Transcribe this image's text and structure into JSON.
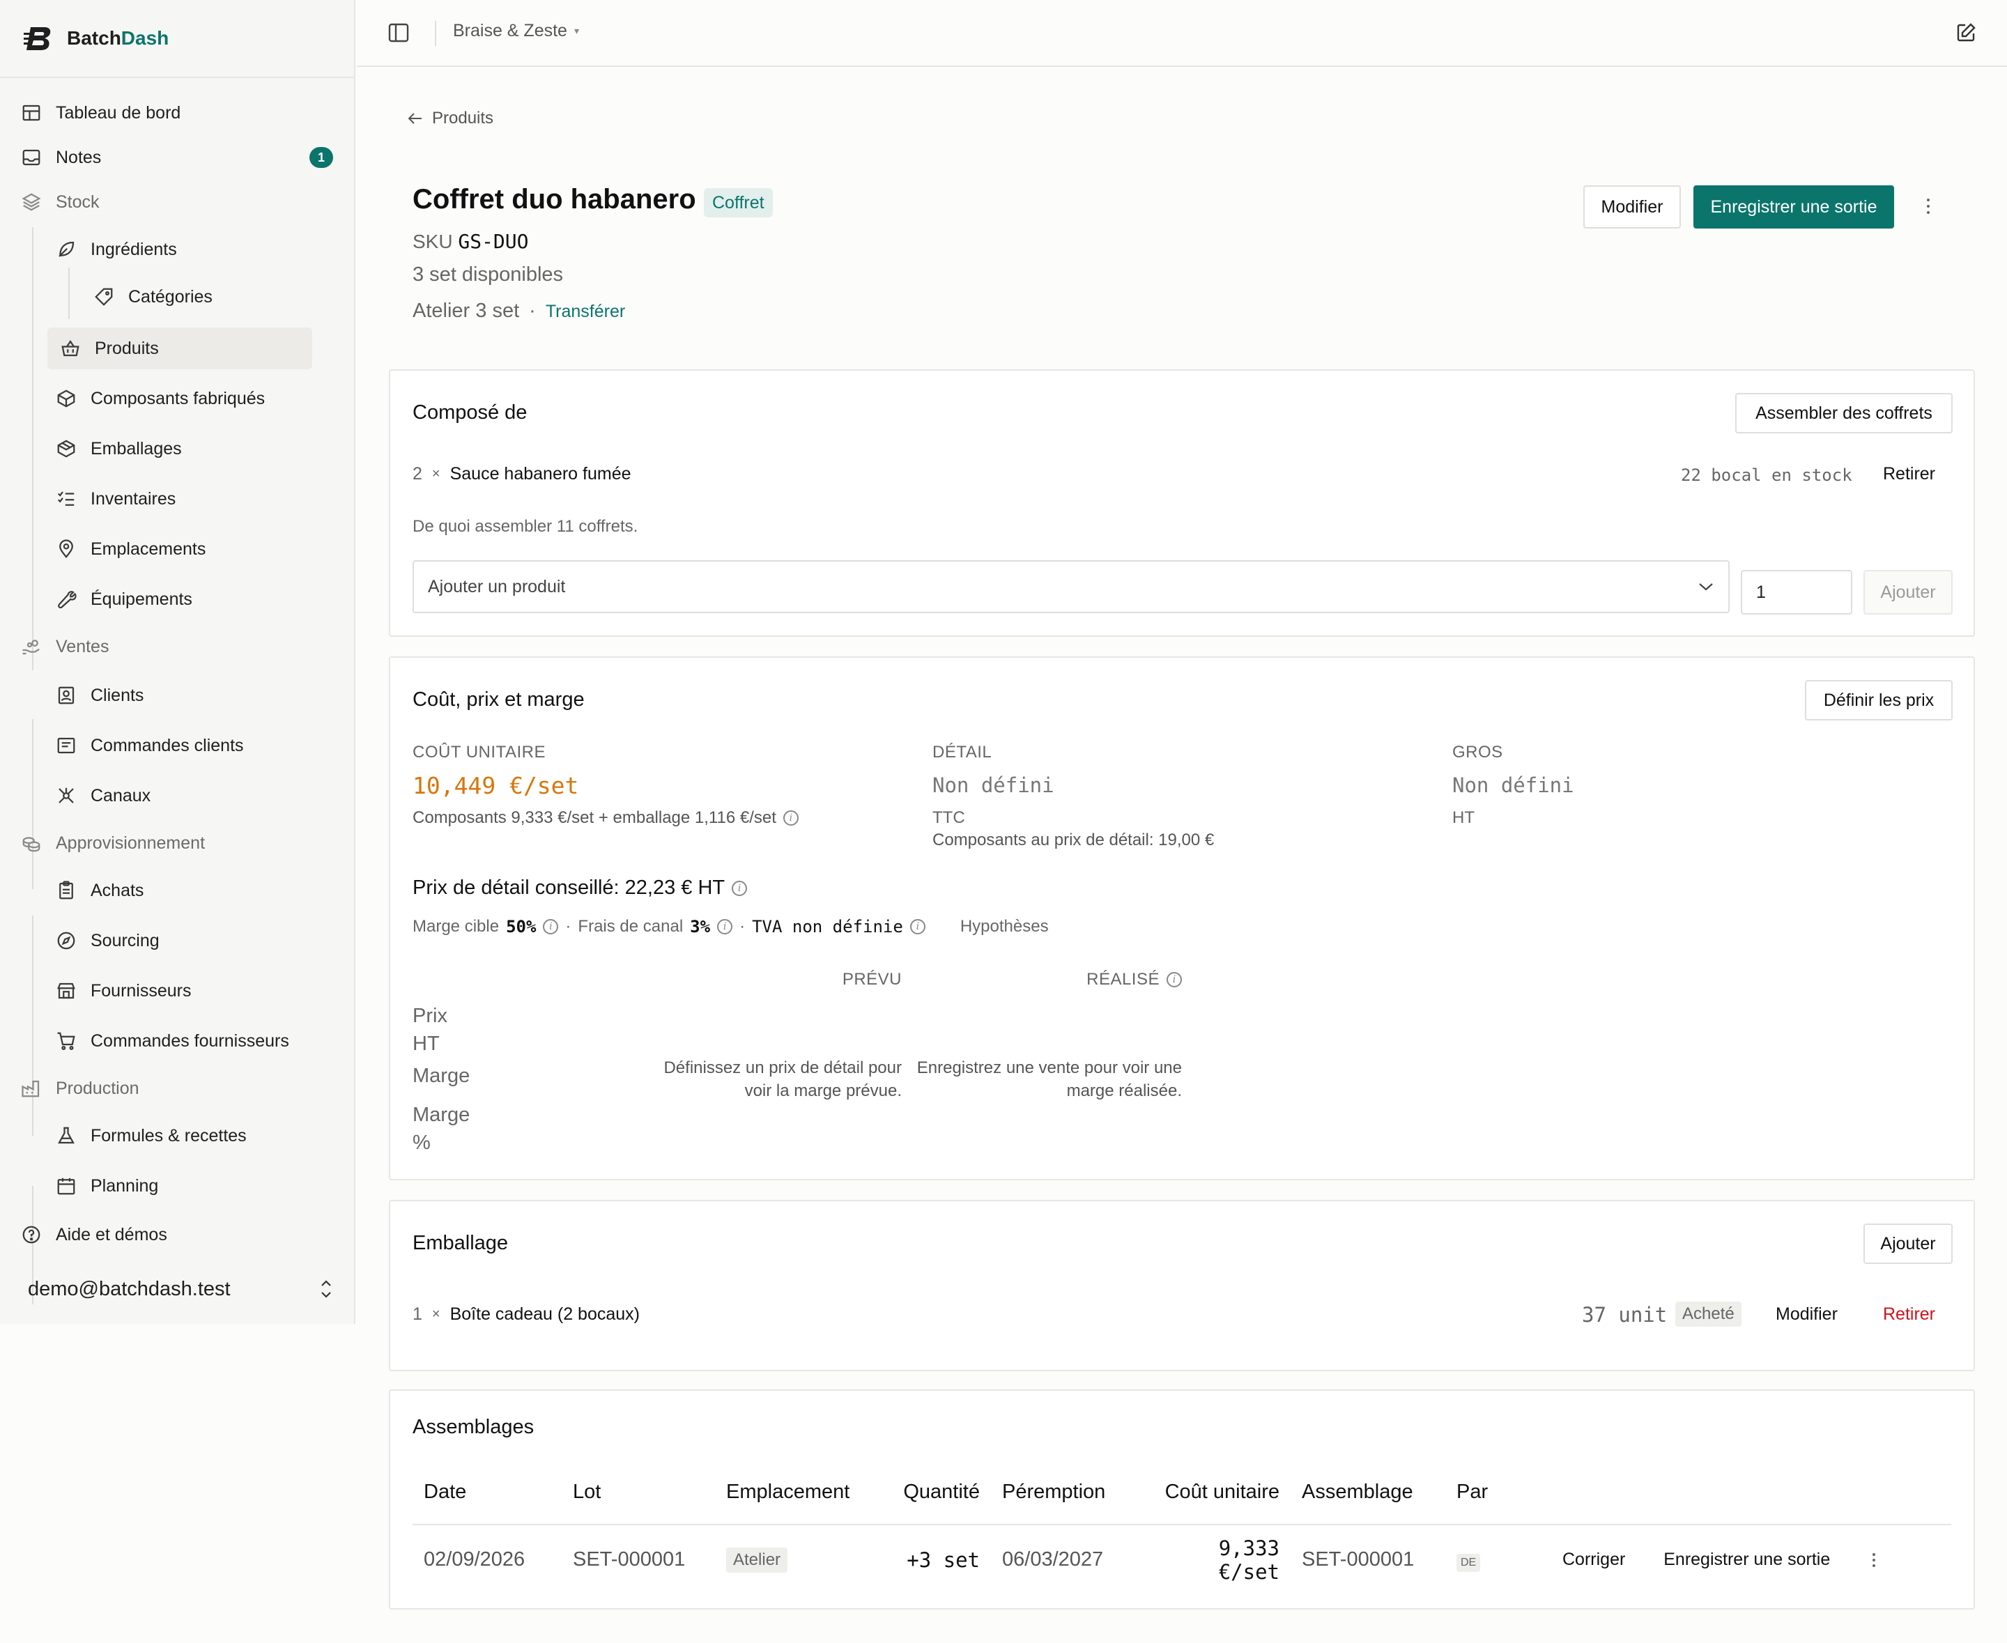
{
  "brand": {
    "name_a": "Batch",
    "name_b": "Dash"
  },
  "sidebar": {
    "items": [
      {
        "label": "Tableau de bord"
      },
      {
        "label": "Notes",
        "badge": "1"
      },
      {
        "label": "Stock"
      },
      {
        "label": "Ingrédients"
      },
      {
        "label": "Catégories"
      },
      {
        "label": "Produits"
      },
      {
        "label": "Composants fabriqués"
      },
      {
        "label": "Emballages"
      },
      {
        "label": "Inventaires"
      },
      {
        "label": "Emplacements"
      },
      {
        "label": "Équipements"
      },
      {
        "label": "Ventes"
      },
      {
        "label": "Clients"
      },
      {
        "label": "Commandes clients"
      },
      {
        "label": "Canaux"
      },
      {
        "label": "Approvisionnement"
      },
      {
        "label": "Achats"
      },
      {
        "label": "Sourcing"
      },
      {
        "label": "Fournisseurs"
      },
      {
        "label": "Commandes fournisseurs"
      },
      {
        "label": "Production"
      },
      {
        "label": "Formules & recettes"
      },
      {
        "label": "Planning"
      },
      {
        "label": "Aide et démos"
      }
    ],
    "user_email": "demo@batchdash.test"
  },
  "topbar": {
    "workspace": "Braise & Zeste",
    "caret": "▾"
  },
  "product": {
    "back_label": "Produits",
    "title": "Coffret duo habanero",
    "type_badge": "Coffret",
    "sku_label": "SKU",
    "sku": "GS-DUO",
    "available": "3 set disponibles",
    "location": "Atelier 3 set",
    "dot": "·",
    "transfer": "Transférer",
    "btn_edit": "Modifier",
    "btn_exit": "Enregistrer une sortie"
  },
  "composition": {
    "title": "Composé de",
    "assemble_btn": "Assembler des coffrets",
    "line_qty": "2",
    "times": "×",
    "line_name": "Sauce habanero fumée",
    "line_stock": "22 bocal en stock",
    "line_remove": "Retirer",
    "note": "De quoi assembler 11 coffrets.",
    "select_placeholder": "Ajouter un produit",
    "qty_value": "1",
    "add_btn": "Ajouter"
  },
  "pricing": {
    "title": "Coût, prix et marge",
    "define_btn": "Définir les prix",
    "unit_cost_label": "COÛT UNITAIRE",
    "unit_cost_value": "10,449 €/set",
    "unit_cost_detail": "Composants 9,333 €/set + emballage 1,116 €/set",
    "retail_label": "DÉTAIL",
    "retail_value": "Non défini",
    "retail_tax": "TTC",
    "retail_note": "Composants au prix de détail: 19,00 €",
    "wholesale_label": "GROS",
    "wholesale_value": "Non défini",
    "wholesale_tax": "HT",
    "suggested": "Prix de détail conseillé: 22,23 € HT",
    "margin_target_label": "Marge cible",
    "margin_target_value": "50%",
    "channel_fee_label": "Frais de canal",
    "channel_fee_value": "3%",
    "vat": "TVA non définie",
    "hypotheses": "Hypothèses",
    "col_planned": "PRÉVU",
    "col_actual": "RÉALISÉ",
    "row_price_a": "Prix",
    "row_price_b": "HT",
    "row_margin": "Marge",
    "row_margin_pct_a": "Marge",
    "row_margin_pct_b": "%",
    "planned_msg_a": "Définissez un prix de détail pour",
    "planned_msg_b": "voir la marge prévue.",
    "actual_msg_a": "Enregistrez une vente pour voir une",
    "actual_msg_b": "marge réalisée."
  },
  "packaging": {
    "title": "Emballage",
    "add_btn": "Ajouter",
    "line_qty": "1",
    "times": "×",
    "line_name": "Boîte cadeau (2 bocaux)",
    "line_stock": "37 unit",
    "line_tag": "Acheté",
    "line_edit": "Modifier",
    "line_remove": "Retirer"
  },
  "assemblies": {
    "title": "Assemblages",
    "headers": [
      "Date",
      "Lot",
      "Emplacement",
      "Quantité",
      "Péremption",
      "Coût unitaire",
      "Assemblage",
      "Par"
    ],
    "row": {
      "date": "02/09/2026",
      "lot": "SET-000001",
      "location": "Atelier",
      "qty": "+3 set",
      "expiry": "06/03/2027",
      "unit_cost": "9,333 €/set",
      "assembly": "SET-000001",
      "by": "DE",
      "fix": "Corriger",
      "exit": "Enregistrer une sortie"
    }
  },
  "colors": {
    "accent": "#0b756c",
    "cost": "#d9760a",
    "danger": "#d0111b"
  }
}
